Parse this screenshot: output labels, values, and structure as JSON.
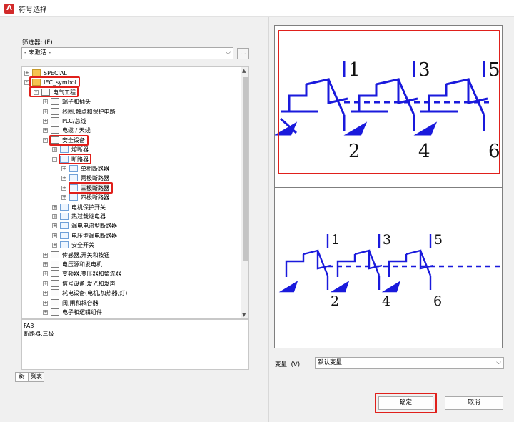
{
  "window": {
    "title": "符号选择",
    "icon": "app-logo-icon"
  },
  "filter": {
    "label": "筛选器: (F)",
    "value": "- 未激活 -",
    "more_button": "..."
  },
  "tree": {
    "items": [
      {
        "label": "SPECIAL",
        "level": 0,
        "icon": "folder",
        "exp": "+"
      },
      {
        "label": "IEC_symbol",
        "level": 0,
        "icon": "folder",
        "exp": "-"
      },
      {
        "label": "电气工程",
        "level": 1,
        "icon": "box",
        "exp": "-"
      },
      {
        "label": "端子和插头",
        "level": 2,
        "icon": "box",
        "exp": "+"
      },
      {
        "label": "线圈,触点和保护电路",
        "level": 2,
        "icon": "box",
        "exp": "+"
      },
      {
        "label": "PLC/总线",
        "level": 2,
        "icon": "box",
        "exp": "+"
      },
      {
        "label": "电缆 / 天线",
        "level": 2,
        "icon": "box",
        "exp": "+"
      },
      {
        "label": "安全设备",
        "level": 2,
        "icon": "box",
        "exp": "-"
      },
      {
        "label": "熔断器",
        "level": 3,
        "icon": "dots",
        "exp": "+"
      },
      {
        "label": "断路器",
        "level": 3,
        "icon": "dots",
        "exp": "-"
      },
      {
        "label": "单相断路器",
        "level": 4,
        "icon": "dots",
        "exp": "+"
      },
      {
        "label": "两极断路器",
        "level": 4,
        "icon": "dots",
        "exp": "+"
      },
      {
        "label": "三极断路器",
        "level": 4,
        "icon": "dots",
        "exp": "+",
        "selected": true
      },
      {
        "label": "四极断路器",
        "level": 4,
        "icon": "dots",
        "exp": "+"
      },
      {
        "label": "电机保护开关",
        "level": 3,
        "icon": "dots",
        "exp": "+"
      },
      {
        "label": "热过载继电器",
        "level": 3,
        "icon": "dots",
        "exp": "+"
      },
      {
        "label": "漏电电流型断路器",
        "level": 3,
        "icon": "dots",
        "exp": "+"
      },
      {
        "label": "电压型漏电断路器",
        "level": 3,
        "icon": "dots",
        "exp": "+"
      },
      {
        "label": "安全开关",
        "level": 3,
        "icon": "dots",
        "exp": "+"
      },
      {
        "label": "传感器,开关和按钮",
        "level": 2,
        "icon": "box",
        "exp": "+"
      },
      {
        "label": "电压源和发电机",
        "level": 2,
        "icon": "box",
        "exp": "+"
      },
      {
        "label": "变频器,变压器和整流器",
        "level": 2,
        "icon": "box",
        "exp": "+"
      },
      {
        "label": "信号设备,发光和发声",
        "level": 2,
        "icon": "box",
        "exp": "+"
      },
      {
        "label": "耗电设备(电机,加热器,灯)",
        "level": 2,
        "icon": "box",
        "exp": "+"
      },
      {
        "label": "阀,闸和耦合器",
        "level": 2,
        "icon": "box",
        "exp": "+"
      },
      {
        "label": "电子和逻辑组件",
        "level": 2,
        "icon": "box",
        "exp": "+"
      }
    ]
  },
  "info": {
    "line1": "FA3",
    "line2": "断路器,三极"
  },
  "tabs": {
    "tree": "树",
    "list": "列表"
  },
  "preview": {
    "top_labels": [
      "1",
      "3",
      "5",
      "2",
      "4",
      "6"
    ],
    "bottom_labels": [
      "1",
      "3",
      "5",
      "2",
      "4",
      "6"
    ],
    "symbol_color": "#1a1adc"
  },
  "variant": {
    "label": "变量: (V)",
    "value": "默认变量"
  },
  "buttons": {
    "ok": "确定",
    "cancel": "取消"
  },
  "colors": {
    "highlight": "#e0201b",
    "symbol": "#1a1adc"
  }
}
